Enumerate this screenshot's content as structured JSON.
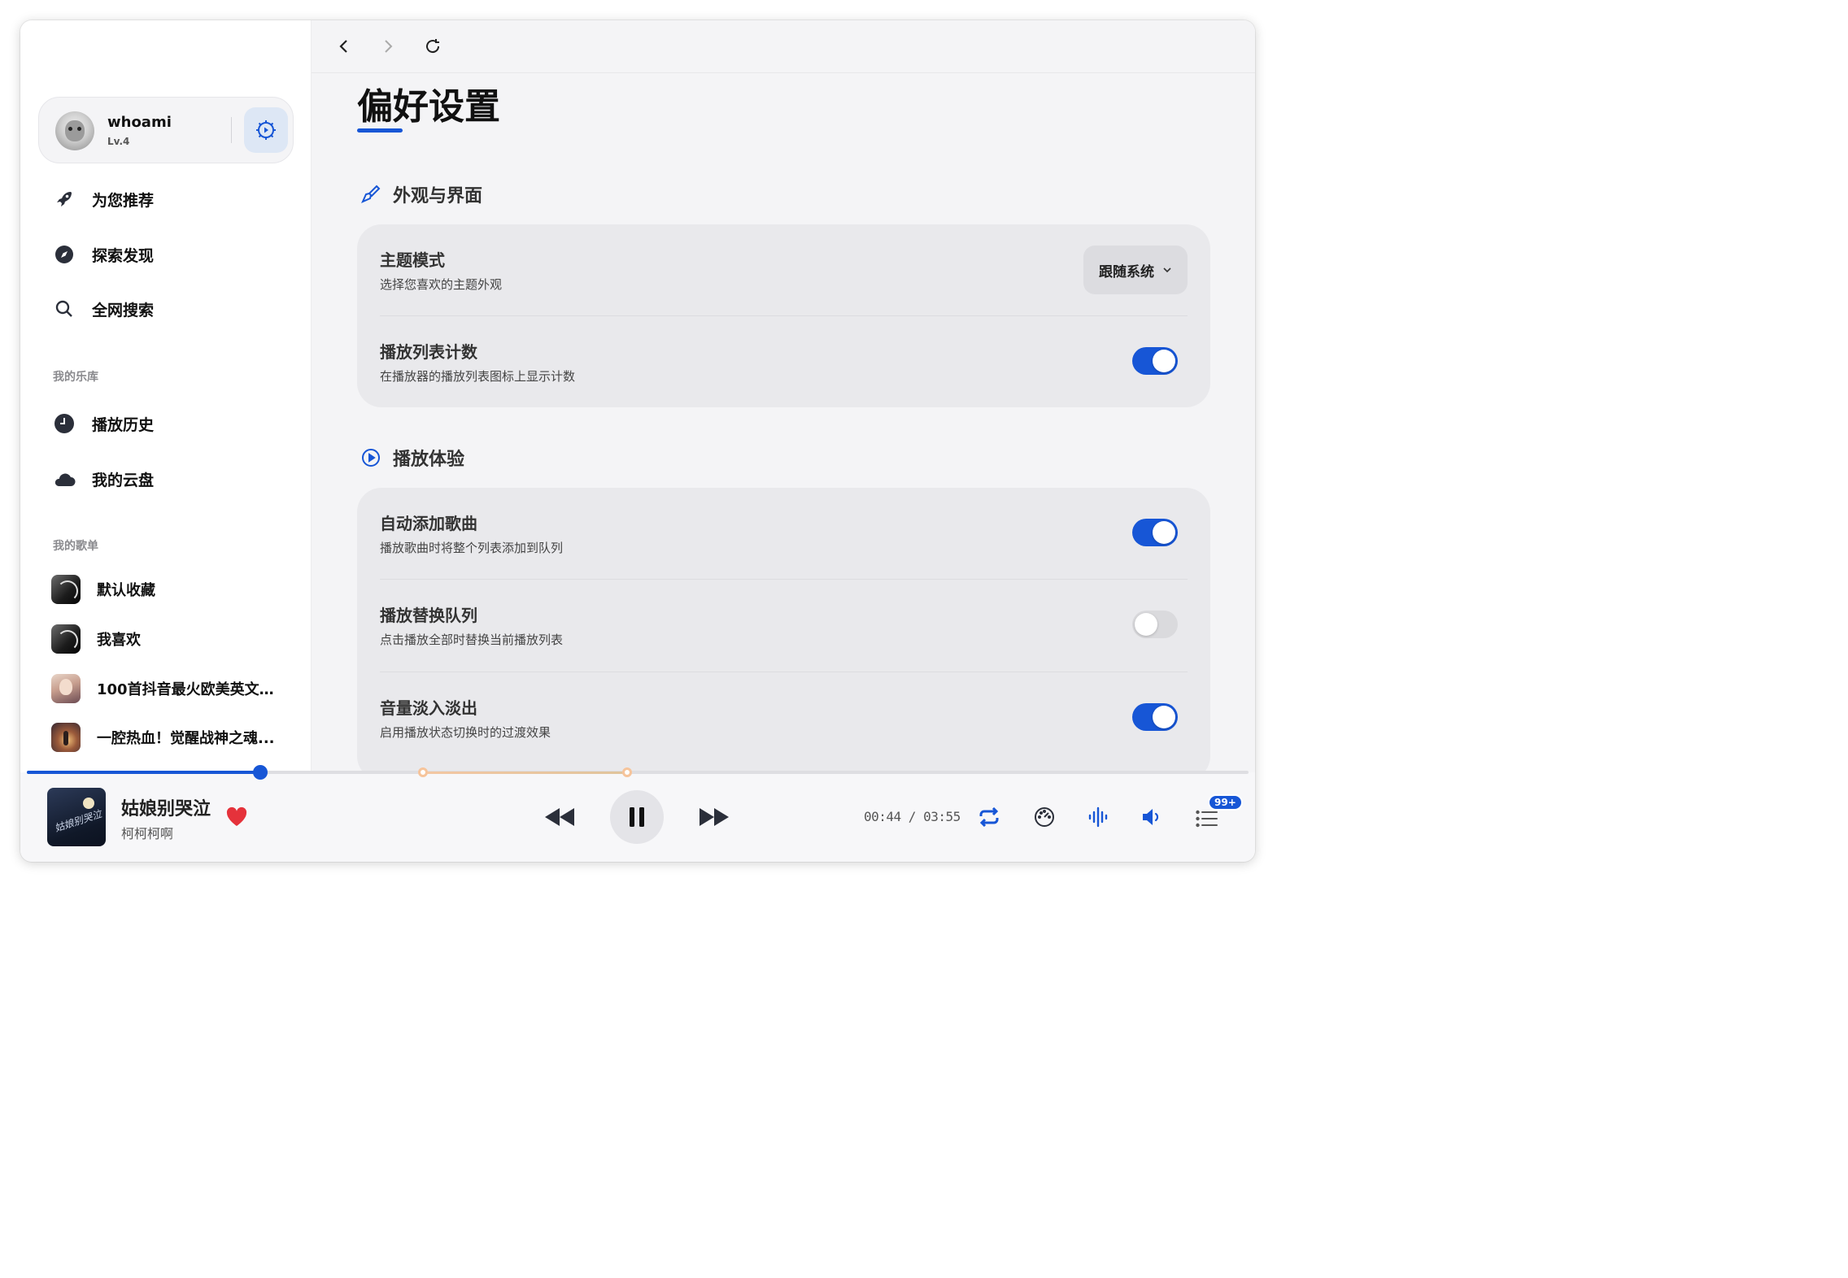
{
  "user": {
    "name": "whoami",
    "level": "Lv.4"
  },
  "nav": [
    {
      "label": "为您推荐",
      "icon": "rocket-icon"
    },
    {
      "label": "探索发现",
      "icon": "compass-icon"
    },
    {
      "label": "全网搜索",
      "icon": "search-icon"
    }
  ],
  "library": {
    "label": "我的乐库",
    "items": [
      {
        "label": "播放历史",
        "icon": "clock-icon"
      },
      {
        "label": "我的云盘",
        "icon": "cloud-icon"
      }
    ]
  },
  "playlists": {
    "label": "我的歌单",
    "items": [
      {
        "name": "默认收藏"
      },
      {
        "name": "我喜欢"
      },
      {
        "name": "100首抖音最火欧美英文..."
      },
      {
        "name": "一腔热血！觉醒战神之魂..."
      }
    ]
  },
  "page": {
    "title": "偏好设置",
    "sections": [
      {
        "title": "外观与界面",
        "icon": "paintbrush-icon",
        "rows": [
          {
            "title": "主题模式",
            "subtitle": "选择您喜欢的主题外观",
            "control": "select",
            "value": "跟随系统"
          },
          {
            "title": "播放列表计数",
            "subtitle": "在播放器的播放列表图标上显示计数",
            "control": "toggle",
            "on": true
          }
        ]
      },
      {
        "title": "播放体验",
        "icon": "play-circle-icon",
        "rows": [
          {
            "title": "自动添加歌曲",
            "subtitle": "播放歌曲时将整个列表添加到队列",
            "control": "toggle",
            "on": true
          },
          {
            "title": "播放替换队列",
            "subtitle": "点击播放全部时替换当前播放列表",
            "control": "toggle",
            "on": false
          },
          {
            "title": "音量淡入淡出",
            "subtitle": "启用播放状态切换时的过渡效果",
            "control": "toggle",
            "on": true
          }
        ]
      }
    ]
  },
  "player": {
    "song": "姑娘别哭泣",
    "artist": "柯柯柯啊",
    "time": "00:44 / 03:55",
    "progress": 0.19,
    "liked": true,
    "queue_badge": "99+",
    "cover_text": "姑娘别哭泣"
  },
  "colors": {
    "accent": "#1756d6",
    "heart": "#e5323b"
  }
}
